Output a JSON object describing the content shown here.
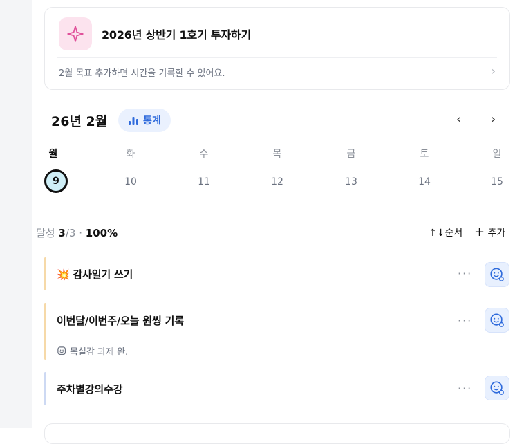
{
  "goal": {
    "title": "2026년 상반기 1호기 투자하기",
    "subtitle": "2월 목표  추가하면 시간을 기록할 수 있어요."
  },
  "calendar": {
    "month_label": "26년 2월",
    "stats_label": "통계",
    "weekdays": [
      "월",
      "화",
      "수",
      "목",
      "금",
      "토",
      "일"
    ],
    "dates": [
      "9",
      "10",
      "11",
      "12",
      "13",
      "14",
      "15"
    ],
    "selected_date": "9"
  },
  "summary": {
    "label": "달성",
    "done": "3",
    "total": "/3",
    "separator": "·",
    "percent": "100%",
    "sort_label": "순서",
    "add_label": "추가"
  },
  "tasks": [
    {
      "emoji": "💥",
      "title": "감사일기 쓰기",
      "bar_color": "#f6d9a8"
    },
    {
      "title": "이번달/이번주/오늘 원씽 기록",
      "note": "목실감 과제 완.",
      "bar_color": "#f6d9a8"
    },
    {
      "title": "주차별강의수강",
      "bar_color": "#cdd9f3"
    }
  ],
  "colors": {
    "accent_blue": "#2f6bdc",
    "goal_icon_bg": "#fce3ee",
    "selected_date_bg": "#cfeff7"
  }
}
